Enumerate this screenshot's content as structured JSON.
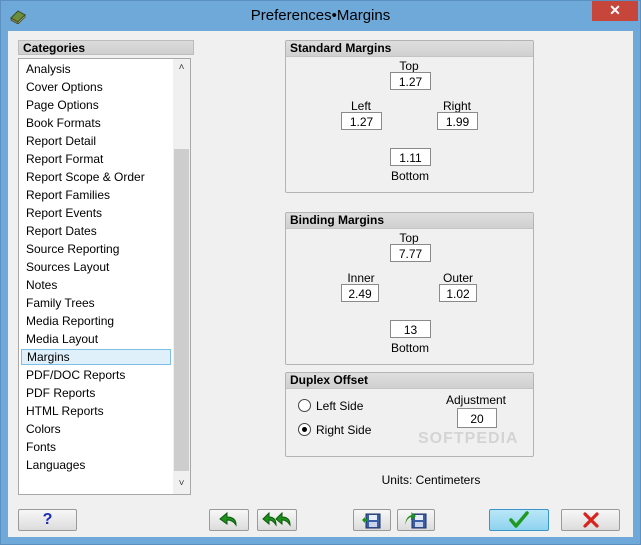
{
  "window": {
    "title": "Preferences•Margins",
    "close_glyph": "✕"
  },
  "categories": {
    "header": "Categories",
    "items": [
      "Analysis",
      "Cover Options",
      "Page Options",
      "Book Formats",
      "Report Detail",
      "Report Format",
      "Report Scope & Order",
      "Report Families",
      "Report Events",
      "Report Dates",
      "Source Reporting",
      "Sources Layout",
      "Notes",
      "Family Trees",
      "Media Reporting",
      "Media Layout",
      "Margins",
      "PDF/DOC Reports",
      "PDF Reports",
      "HTML Reports",
      "Colors",
      "Fonts",
      "Languages"
    ],
    "selected": "Margins",
    "scroll_up": "˄",
    "scroll_down": "˅"
  },
  "standard_margins": {
    "title": "Standard Margins",
    "top_label": "Top",
    "top_value": "1.27",
    "left_label": "Left",
    "left_value": "1.27",
    "right_label": "Right",
    "right_value": "1.99",
    "bottom_label": "Bottom",
    "bottom_value": "1.11"
  },
  "binding_margins": {
    "title": "Binding Margins",
    "top_label": "Top",
    "top_value": "7.77",
    "inner_label": "Inner",
    "inner_value": "2.49",
    "outer_label": "Outer",
    "outer_value": "1.02",
    "bottom_label": "Bottom",
    "bottom_value": "13"
  },
  "duplex_offset": {
    "title": "Duplex Offset",
    "left_side_label": "Left Side",
    "right_side_label": "Right Side",
    "selected": "Right Side",
    "adjustment_label": "Adjustment",
    "adjustment_value": "20"
  },
  "units_text": "Units: Centimeters",
  "watermark": "SOFTPEDIA",
  "buttons": {
    "help_label": "?",
    "undo_icon": "undo-arrow",
    "undo_all_icon": "undo-all-arrows",
    "save_icon": "save-floppy",
    "save_as_icon": "save-as-floppy",
    "ok_icon": "check-mark",
    "cancel_icon": "x-mark"
  },
  "colors": {
    "title_bar": "#6ea9d9",
    "close_button": "#c7463b",
    "ok_button": "#8fd3ef",
    "check_green": "#1f9a1f",
    "cancel_red": "#d8241c",
    "undo_green": "#1c8f1c"
  }
}
